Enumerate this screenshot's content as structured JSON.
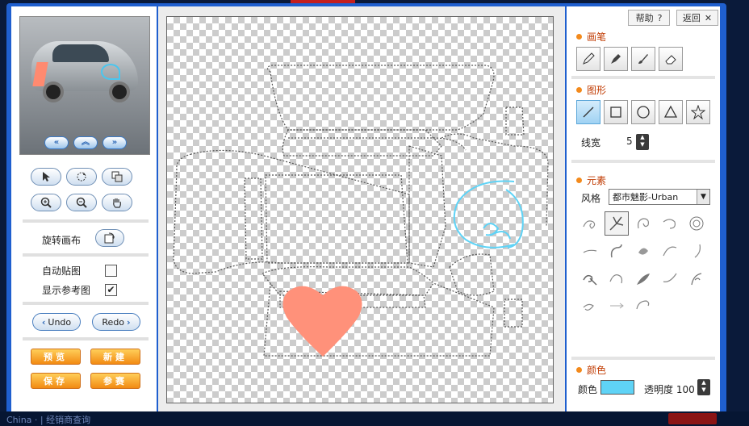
{
  "footer": {
    "text": "China ·  | 经销商查询"
  },
  "left": {
    "view_buttons": [
      {
        "name": "view-prev-button",
        "label": "«"
      },
      {
        "name": "view-up-button",
        "label": "︽"
      },
      {
        "name": "view-next-button",
        "label": "»"
      }
    ],
    "rotate_label": "旋转画布",
    "auto_paste_label": "自动贴图",
    "show_reference_label": "显示参考图",
    "auto_paste_checked": false,
    "show_reference_checked": true,
    "undo_label": "Undo",
    "redo_label": "Redo",
    "actions": {
      "preview": "预览",
      "new": "新建",
      "save": "保存",
      "join": "参赛"
    }
  },
  "right": {
    "help_label": "帮助",
    "back_label": "返回",
    "brush_title": "画笔",
    "shape_title": "图形",
    "line_width_label": "线宽",
    "line_width_value": "5",
    "element_title": "元素",
    "style_label": "风格",
    "style_value": "都市魅影-Urban",
    "color_title": "颜色",
    "color_label": "颜色",
    "color_value": "#5fd3f6",
    "opacity_label": "透明度",
    "opacity_value": "100"
  },
  "canvas": {
    "heart_color": "#ff917a",
    "swirl_color": "#5fd3f6"
  }
}
